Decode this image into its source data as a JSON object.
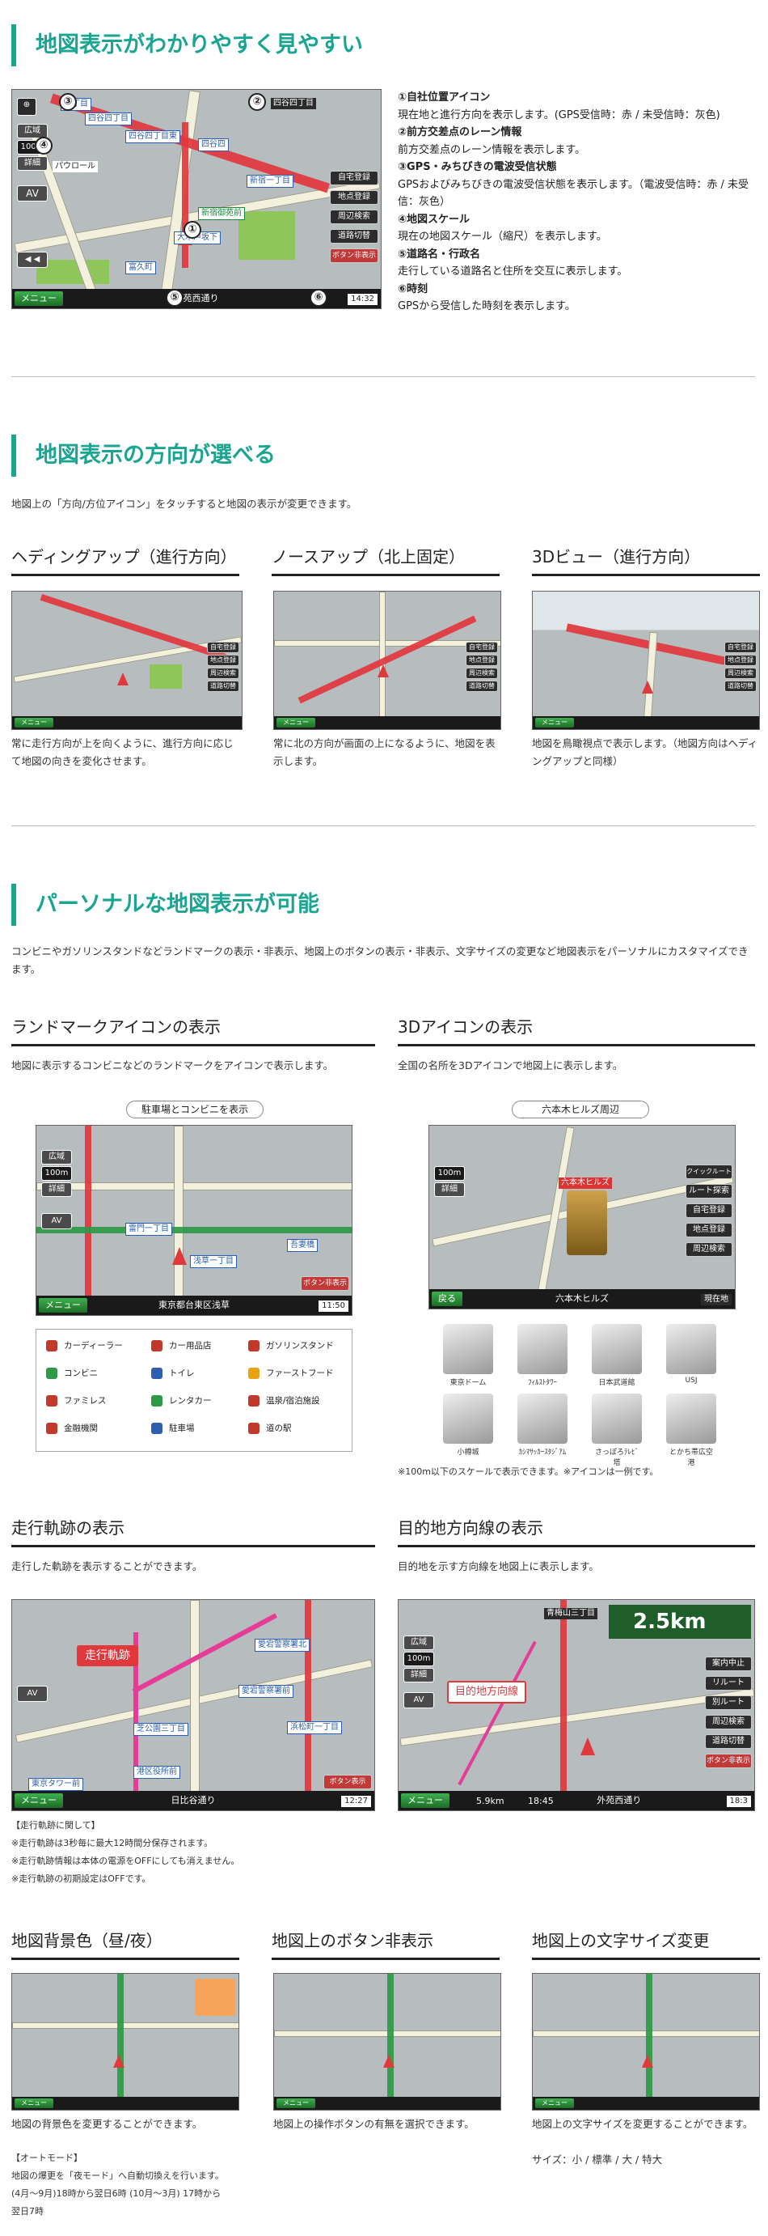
{
  "sections": {
    "s1": {
      "title": "地図表示がわかりやすく見やすい"
    },
    "s2": {
      "title": "地図表示の方向が選べる",
      "intro": "地図上の「方向/方位アイコン」をタッチすると地図の表示が変更できます。"
    },
    "s3": {
      "title": "パーソナルな地図表示が可能",
      "intro": "コンビニやガソリンスタンドなどランドマークの表示・非表示、地図上のボタンの表示・非表示、文字サイズの変更など地図表示をパーソナルにカスタマイズできます。"
    }
  },
  "features": [
    {
      "num": "①",
      "title": "自社位置アイコン",
      "text": "現在地と進行方向を表示します。(GPS受信時：赤 / 未受信時：灰色)"
    },
    {
      "num": "②",
      "title": "前方交差点のレーン情報",
      "text": "前方交差点のレーン情報を表示します。"
    },
    {
      "num": "③",
      "title": "GPS・みちびきの電波受信状態",
      "text": "GPSおよびみちびきの電波受信状態を表示します。（電波受信時：赤 / 未受信：灰色）"
    },
    {
      "num": "④",
      "title": "地図スケール",
      "text": "現在の地図スケール（縮尺）を表示します。"
    },
    {
      "num": "⑤",
      "title": "道路名・行政名",
      "text": "走行している道路名と住所を交互に表示します。"
    },
    {
      "num": "⑥",
      "title": "時刻",
      "text": "GPSから受信した時刻を表示します。"
    }
  ],
  "map_ui": {
    "wide": "広域",
    "scale": "100m",
    "detail": "詳細",
    "av": "AV",
    "menu": "メニュー",
    "right_buttons": [
      "自宅登録",
      "地点登録",
      "周辺検索",
      "道路切替",
      "ボタン非表示"
    ],
    "road": "外苑西通り",
    "time": "14:32",
    "labels": {
      "a": "四谷四丁目",
      "b": "四谷四丁目東",
      "c": "四谷四",
      "d": "新宿一丁目",
      "e": "大木戸坂下",
      "f": "富久町",
      "g": "パウロール",
      "h": "新宿御苑前",
      "i": "大木戸",
      "j": "二丁目"
    },
    "callouts": [
      "①",
      "②",
      "③",
      "④",
      "⑤",
      "⑥"
    ]
  },
  "orientation": [
    {
      "title": "ヘディングアップ（進行方向）",
      "desc": "常に走行方向が上を向くように、進行方向に応じて地図の向きを変化させます。"
    },
    {
      "title": "ノースアップ（北上固定）",
      "desc": "常に北の方向が画面の上になるように、地図を表示します。"
    },
    {
      "title": "3Dビュー（進行方向）",
      "desc": "地図を鳥瞰視点で表示します。（地図方向はヘディングアップと同様）"
    }
  ],
  "landmark": {
    "title": "ランドマークアイコンの表示",
    "desc": "地図に表示するコンビニなどのランドマークをアイコンで表示します。",
    "pill": "駐車場とコンビニを表示",
    "road": "東京都台東区浅草",
    "time": "11:50",
    "legend": [
      {
        "label": "カーディーラー",
        "color": "#c0392b"
      },
      {
        "label": "カー用品店",
        "color": "#c0392b"
      },
      {
        "label": "ガソリンスタンド",
        "color": "#c0392b"
      },
      {
        "label": "コンビニ",
        "color": "#2e9a47"
      },
      {
        "label": "トイレ",
        "color": "#2c5fb0"
      },
      {
        "label": "ファーストフード",
        "color": "#e8a317"
      },
      {
        "label": "ファミレス",
        "color": "#c0392b"
      },
      {
        "label": "レンタカー",
        "color": "#2e9a47"
      },
      {
        "label": "温泉/宿泊施設",
        "color": "#c0392b"
      },
      {
        "label": "金融機関",
        "color": "#c0392b"
      },
      {
        "label": "駐車場",
        "color": "#2c5fb0"
      },
      {
        "label": "道の駅",
        "color": "#c0392b"
      }
    ]
  },
  "icon3d": {
    "title": "3Dアイコンの表示",
    "desc": "全国の名所を3Dアイコンで地図上に表示します。",
    "pill": "六本木ヒルズ周辺",
    "back": "戻る",
    "here": "現在地",
    "road": "六本木ヒルズ",
    "buttons": [
      "クイックルート",
      "ルート探索",
      "自宅登録",
      "地点登録",
      "周辺検索"
    ],
    "tiles": [
      "東京ドーム",
      "ﾌｨﾙｽﾄﾀﾜｰ",
      "日本武道館",
      "USJ",
      "小樽城",
      "ｶｼﾏｻｯｶｰｽﾀｼﾞｱﾑ",
      "さっぽろﾃﾚﾋﾞ塔",
      "とかち帯広空港"
    ],
    "note": "※100m以下のスケールで表示できます。※アイコンは一例です。"
  },
  "track": {
    "title": "走行軌跡の表示",
    "desc": "走行した軌跡を表示することができます。",
    "callout": "走行軌跡",
    "road": "日比谷通り",
    "time": "12:27",
    "notes_head": "【走行軌跡に関して】",
    "notes": [
      "※走行軌跡は3秒毎に最大12時間分保存されます。",
      "※走行軌跡情報は本体の電源をOFFにしても消えません。",
      "※走行軌跡の初期設定はOFFです。"
    ]
  },
  "dest": {
    "title": "目的地方向線の表示",
    "desc": "目的地を示す方向線を地図上に表示します。",
    "callout": "目的地方向線",
    "distance": "2.5km",
    "road": "外苑西通り",
    "time": "18:3",
    "buttons": [
      "案内中止",
      "リルート",
      "別ルート",
      "周辺検索",
      "道路切替",
      "ボタン非表示"
    ],
    "dist_left": "5.9km",
    "eta": "18:45",
    "dest_name": "青梅山三丁目"
  },
  "bottom": [
    {
      "title": "地図背景色（昼/夜）",
      "desc": "地図の背景色を変更することができます。",
      "extra": [
        "【オートモード】",
        "地図の爆更を「夜モード」へ自動切換えを行います。",
        "(4月〜9月)18時から翌日6時 (10月〜3月) 17時から",
        "翌日7時"
      ]
    },
    {
      "title": "地図上のボタン非表示",
      "desc": "地図上の操作ボタンの有無を選択できます。",
      "extra": []
    },
    {
      "title": "地図上の文字サイズ変更",
      "desc": "地図上の文字サイズを変更することができます。",
      "extra": [
        "サイズ：小 / 標準 / 大 / 特大"
      ]
    }
  ]
}
